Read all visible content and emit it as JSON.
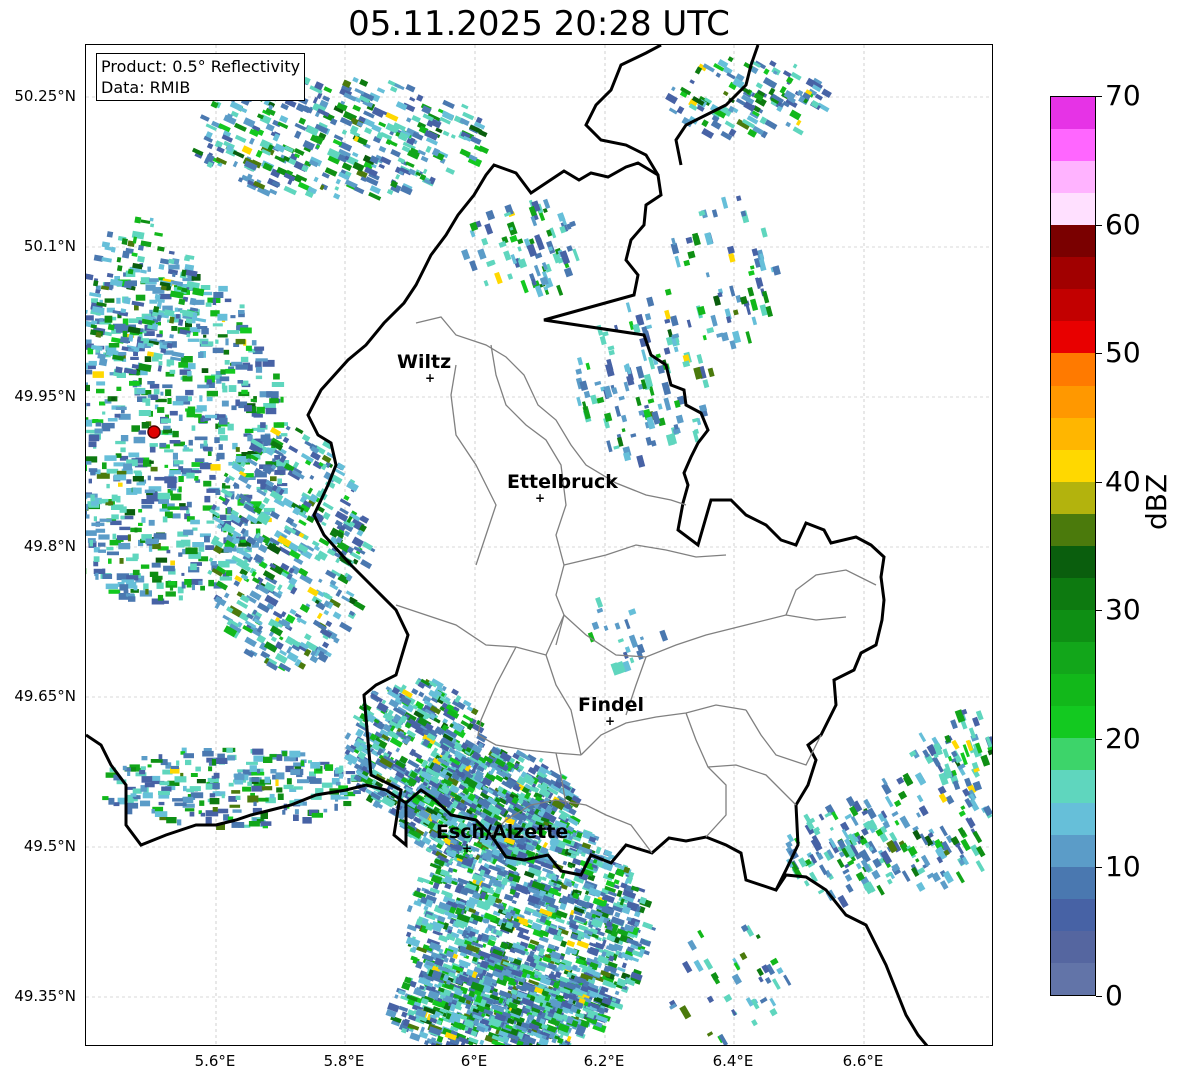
{
  "title": "05.11.2025 20:28 UTC",
  "infobox": {
    "product": "Product: 0.5° Reflectivity",
    "data": "Data: RMIB"
  },
  "lat_labels": [
    "50.25°N",
    "50.1°N",
    "49.95°N",
    "49.8°N",
    "49.65°N",
    "49.5°N",
    "49.35°N"
  ],
  "lon_labels": [
    "5.6°E",
    "5.8°E",
    "6°E",
    "6.2°E",
    "6.4°E",
    "6.6°E"
  ],
  "cities": [
    {
      "name": "Wiltz",
      "lon": 5.93,
      "lat": 49.97
    },
    {
      "name": "Ettelbruck",
      "lon": 6.1,
      "lat": 49.85
    },
    {
      "name": "Findel",
      "lon": 6.21,
      "lat": 49.63
    },
    {
      "name": "Esch/Alzette",
      "lon": 5.99,
      "lat": 49.5
    }
  ],
  "radar_site": {
    "lon": 5.505,
    "lat": 49.915,
    "color": "#e00000"
  },
  "colorbar": {
    "label": "dBZ",
    "ticks": [
      "0",
      "10",
      "20",
      "30",
      "40",
      "50",
      "60",
      "70"
    ],
    "colors": [
      "#6274a8",
      "#5566a0",
      "#4762a5",
      "#4a78b0",
      "#5b9cc8",
      "#66bfd9",
      "#5fd6be",
      "#3dd46a",
      "#13c920",
      "#12b81a",
      "#12a61a",
      "#0e8f14",
      "#0d7a10",
      "#0a5e0d",
      "#4b7a0c",
      "#b3b30d",
      "#ffd800",
      "#ffb600",
      "#ff9800",
      "#ff7a00",
      "#e80000",
      "#c20000",
      "#a10000",
      "#7a0000",
      "#ffe0ff",
      "#ffb3ff",
      "#ff66ff",
      "#e633e6"
    ]
  },
  "map_extent": {
    "lon_min": 5.4,
    "lon_max": 6.8,
    "lat_min": 49.3,
    "lat_max": 50.3
  },
  "colors": {
    "border": "#000000",
    "district": "#808080",
    "grid": "#b5b5b5"
  }
}
